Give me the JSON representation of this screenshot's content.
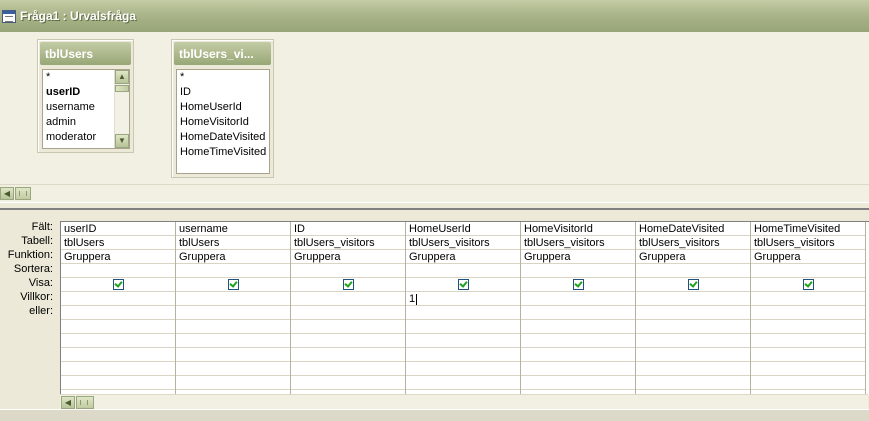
{
  "window": {
    "title": "Fråga1 : Urvalsfråga"
  },
  "tables": [
    {
      "title": "tblUsers",
      "fields": [
        {
          "name": "*",
          "pk": false
        },
        {
          "name": "userID",
          "pk": true
        },
        {
          "name": "username",
          "pk": false
        },
        {
          "name": "admin",
          "pk": false
        },
        {
          "name": "moderator",
          "pk": false
        }
      ]
    },
    {
      "title": "tblUsers_vi...",
      "fields": [
        {
          "name": "*",
          "pk": false
        },
        {
          "name": "ID",
          "pk": false
        },
        {
          "name": "HomeUserId",
          "pk": false
        },
        {
          "name": "HomeVisitorId",
          "pk": false
        },
        {
          "name": "HomeDateVisited",
          "pk": false
        },
        {
          "name": "HomeTimeVisited",
          "pk": false
        }
      ]
    }
  ],
  "grid": {
    "row_labels": {
      "falt": "Fält:",
      "tabell": "Tabell:",
      "funktion": "Funktion:",
      "sortera": "Sortera:",
      "visa": "Visa:",
      "villkor": "Villkor:",
      "eller": "eller:"
    },
    "columns": [
      {
        "field": "userID",
        "table": "tblUsers",
        "function": "Gruppera",
        "sort": "",
        "show": true,
        "criteria": ""
      },
      {
        "field": "username",
        "table": "tblUsers",
        "function": "Gruppera",
        "sort": "",
        "show": true,
        "criteria": ""
      },
      {
        "field": "ID",
        "table": "tblUsers_visitors",
        "function": "Gruppera",
        "sort": "",
        "show": true,
        "criteria": ""
      },
      {
        "field": "HomeUserId",
        "table": "tblUsers_visitors",
        "function": "Gruppera",
        "sort": "",
        "show": true,
        "criteria": "1"
      },
      {
        "field": "HomeVisitorId",
        "table": "tblUsers_visitors",
        "function": "Gruppera",
        "sort": "",
        "show": true,
        "criteria": ""
      },
      {
        "field": "HomeDateVisited",
        "table": "tblUsers_visitors",
        "function": "Gruppera",
        "sort": "",
        "show": true,
        "criteria": ""
      },
      {
        "field": "HomeTimeVisited",
        "table": "tblUsers_visitors",
        "function": "Gruppera",
        "sort": "",
        "show": true,
        "criteria": ""
      }
    ]
  },
  "icons": {
    "scroll_up": "scroll-up-arrow-icon",
    "scroll_down": "scroll-down-arrow-icon",
    "scroll_left": "scroll-left-arrow-icon",
    "window": "query-window-icon"
  },
  "colors": {
    "titlebar": "#a2ae80",
    "workspace": "#f2f0e3",
    "check": "#21a121"
  }
}
